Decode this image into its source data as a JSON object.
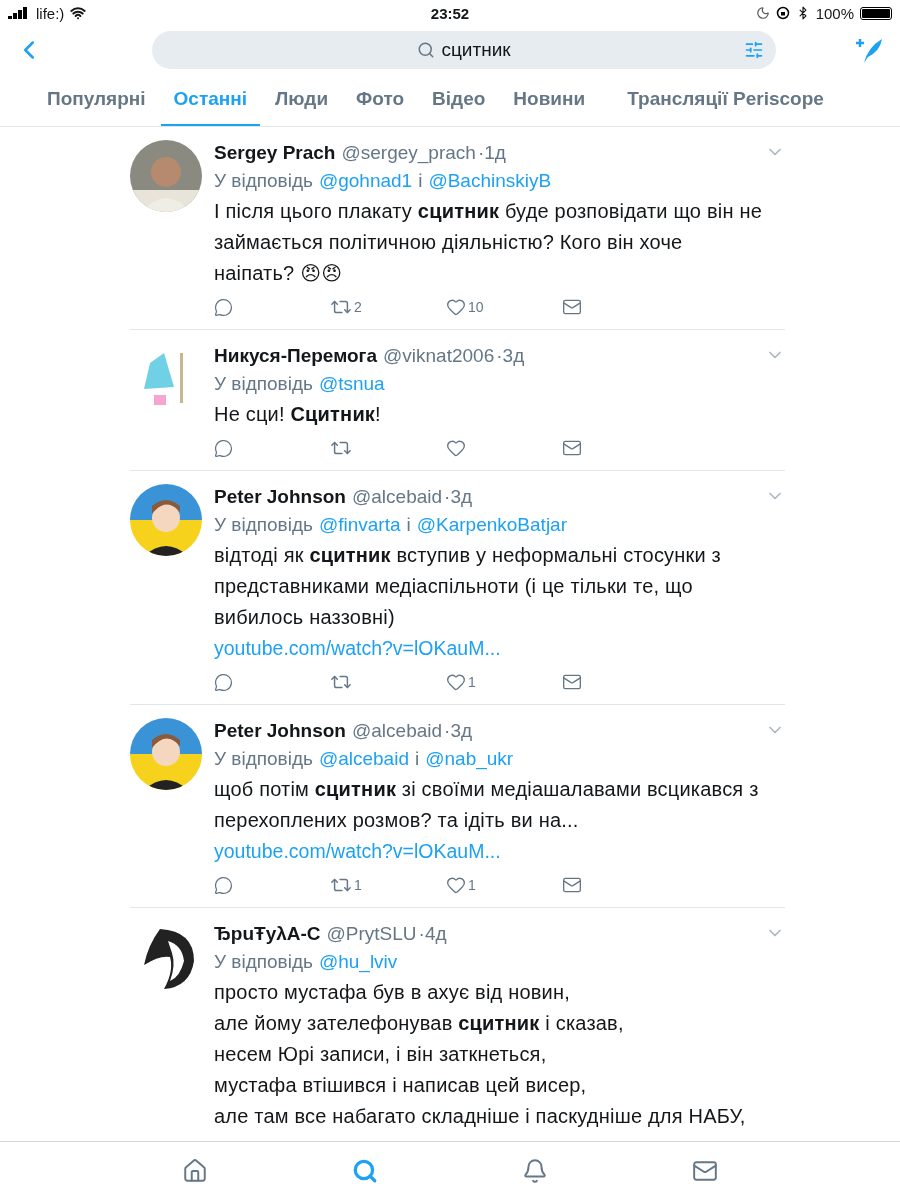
{
  "status_bar": {
    "carrier": "life:)",
    "time": "23:52",
    "battery": "100%"
  },
  "search": {
    "query": "сцитник"
  },
  "tabs": [
    {
      "label": "Популярні",
      "selected": false
    },
    {
      "label": "Останні",
      "selected": true
    },
    {
      "label": "Люди",
      "selected": false
    },
    {
      "label": "Фото",
      "selected": false
    },
    {
      "label": "Відео",
      "selected": false
    },
    {
      "label": "Новини",
      "selected": false
    },
    {
      "label": "Трансляції Periscope",
      "selected": false
    }
  ],
  "tweets": [
    {
      "name": "Sergey Prach",
      "handle": "@sergey_prach",
      "time": "·1д",
      "avatar": {
        "kind": "photo"
      },
      "reply": [
        {
          "kind": "plain",
          "text": "У відповідь"
        },
        {
          "kind": "mention",
          "text": "@gohnad1"
        },
        {
          "kind": "plain",
          "text": "і"
        },
        {
          "kind": "mention",
          "text": "@BachinskiyB"
        }
      ],
      "body": "І після цього плакату **сцитник** буде розповідати що він не займається політичною діяльністю? Кого він хоче наіпать? 😠😠",
      "retweets": "2",
      "likes": "10"
    },
    {
      "name": "Никуся-Перемога",
      "handle": "@viknat2006",
      "time": "·3д",
      "avatar": {
        "kind": "illustration"
      },
      "reply": [
        {
          "kind": "plain",
          "text": "У відповідь"
        },
        {
          "kind": "mention",
          "text": "@tsnua"
        }
      ],
      "body": "Не сци! **Сцитник**!"
    },
    {
      "name": "Peter Johnson",
      "handle": "@alcebaid",
      "time": "·3д",
      "avatar": {
        "kind": "flag"
      },
      "reply": [
        {
          "kind": "plain",
          "text": "У відповідь"
        },
        {
          "kind": "mention",
          "text": "@finvarta"
        },
        {
          "kind": "plain",
          "text": "і"
        },
        {
          "kind": "mention",
          "text": "@KarpenkoBatjar"
        }
      ],
      "body": "відтоді як **сцитник** вступив у неформальні стосунки з представниками медіаспільноти (і це тільки те, що вибилось наззовні)",
      "link": "youtube.com/watch?v=lOKauM...",
      "likes": "1"
    },
    {
      "name": "Peter Johnson",
      "handle": "@alcebaid",
      "time": "·3д",
      "avatar": {
        "kind": "flag"
      },
      "reply": [
        {
          "kind": "plain",
          "text": "У відповідь"
        },
        {
          "kind": "mention",
          "text": "@alcebaid"
        },
        {
          "kind": "plain",
          "text": "і"
        },
        {
          "kind": "mention",
          "text": "@nab_ukr"
        }
      ],
      "body": "щоб потім **сцитник** зі своїми медіашалавами всцикався з перехоплених розмов? та ідіть ви на...",
      "link": "youtube.com/watch?v=lOKauM...",
      "retweets": "1",
      "likes": "1"
    },
    {
      "name": "ЂpuŦyλA-C",
      "handle": "@PrytSLU",
      "time": "·4д",
      "avatar": {
        "kind": "lion"
      },
      "reply": [
        {
          "kind": "plain",
          "text": "У відповідь"
        },
        {
          "kind": "mention",
          "text": "@hu_lviv"
        }
      ],
      "body": "просто мустафа був в ахує від новин,\nале йому зателефонував **сцитник** і сказав,\nнесем Юрі записи, і він заткнеться,\nмустафа втішився і написав цей висер,\nале там все набагато складніше і паскудніше для НАБУ,",
      "cut_off": true
    }
  ],
  "bottom_nav": [
    {
      "kind": "home",
      "selected": false
    },
    {
      "kind": "search",
      "selected": true
    },
    {
      "kind": "notifications",
      "selected": false
    },
    {
      "kind": "messages",
      "selected": false
    }
  ]
}
